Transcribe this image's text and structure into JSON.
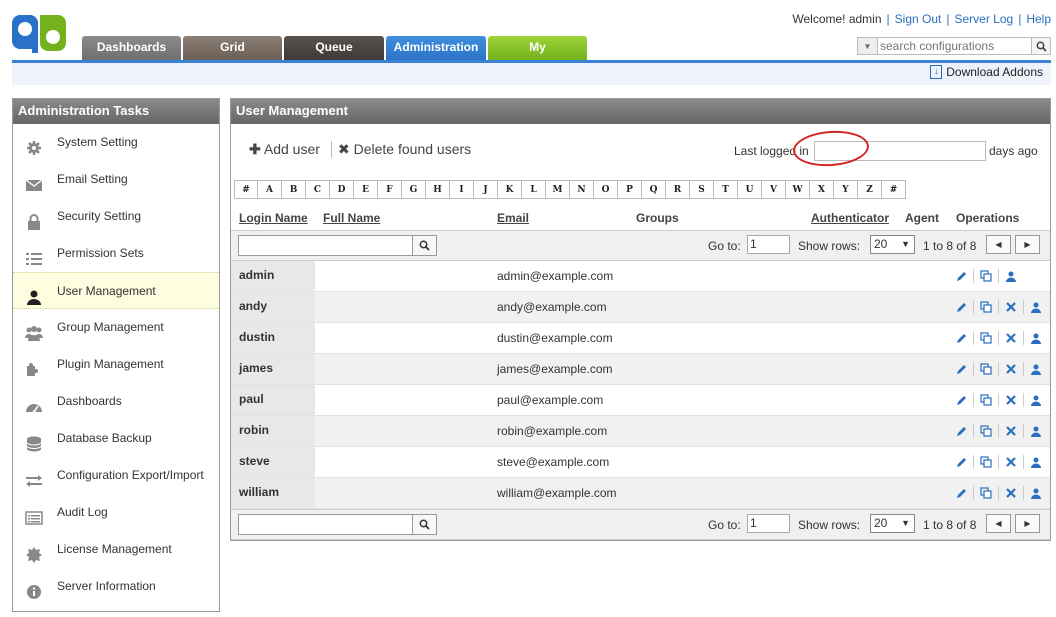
{
  "header": {
    "tabs": [
      "Dashboards",
      "Grid",
      "Queue",
      "Administration",
      "My"
    ],
    "welcome": "Welcome! admin",
    "links": [
      "Sign Out",
      "Server Log",
      "Help"
    ],
    "search_placeholder": "search configurations",
    "download_addons": "Download Addons",
    "accent_color": "#3a82d6"
  },
  "sidebar": {
    "title": "Administration Tasks",
    "items": [
      {
        "label": "System Setting",
        "icon": "gear-icon"
      },
      {
        "label": "Email Setting",
        "icon": "envelope-icon"
      },
      {
        "label": "Security Setting",
        "icon": "lock-icon"
      },
      {
        "label": "Permission Sets",
        "icon": "list-icon"
      },
      {
        "label": "User Management",
        "icon": "user-icon",
        "active": true
      },
      {
        "label": "Group Management",
        "icon": "group-icon"
      },
      {
        "label": "Plugin Management",
        "icon": "puzzle-icon"
      },
      {
        "label": "Dashboards",
        "icon": "dashboard-icon"
      },
      {
        "label": "Database Backup",
        "icon": "database-icon"
      },
      {
        "label": "Configuration Export/Import",
        "icon": "exchange-icon"
      },
      {
        "label": "Audit Log",
        "icon": "log-icon"
      },
      {
        "label": "License Management",
        "icon": "certificate-icon"
      },
      {
        "label": "Server Information",
        "icon": "info-icon"
      }
    ]
  },
  "main": {
    "title": "User Management",
    "add_user": "Add user",
    "delete_found": "Delete found users",
    "last_logged_in": "Last logged in",
    "days_ago": "days ago",
    "alphabet": [
      "#",
      "A",
      "B",
      "C",
      "D",
      "E",
      "F",
      "G",
      "H",
      "I",
      "J",
      "K",
      "L",
      "M",
      "N",
      "O",
      "P",
      "Q",
      "R",
      "S",
      "T",
      "U",
      "V",
      "W",
      "X",
      "Y",
      "Z",
      "#"
    ],
    "columns": {
      "login": "Login Name",
      "full": "Full Name",
      "email": "Email",
      "groups": "Groups",
      "auth": "Authenticator",
      "agent": "Agent",
      "ops": "Operations"
    },
    "pager": {
      "goto": "Go to:",
      "page": "1",
      "show_rows": "Show rows:",
      "rows": "20",
      "count": "1 to 8 of 8"
    },
    "users": [
      {
        "login": "admin",
        "email": "admin@example.com",
        "can_delete": false
      },
      {
        "login": "andy",
        "email": "andy@example.com",
        "can_delete": true
      },
      {
        "login": "dustin",
        "email": "dustin@example.com",
        "can_delete": true
      },
      {
        "login": "james",
        "email": "james@example.com",
        "can_delete": true
      },
      {
        "login": "paul",
        "email": "paul@example.com",
        "can_delete": true
      },
      {
        "login": "robin",
        "email": "robin@example.com",
        "can_delete": true
      },
      {
        "login": "steve",
        "email": "steve@example.com",
        "can_delete": true
      },
      {
        "login": "william",
        "email": "william@example.com",
        "can_delete": true
      }
    ]
  }
}
